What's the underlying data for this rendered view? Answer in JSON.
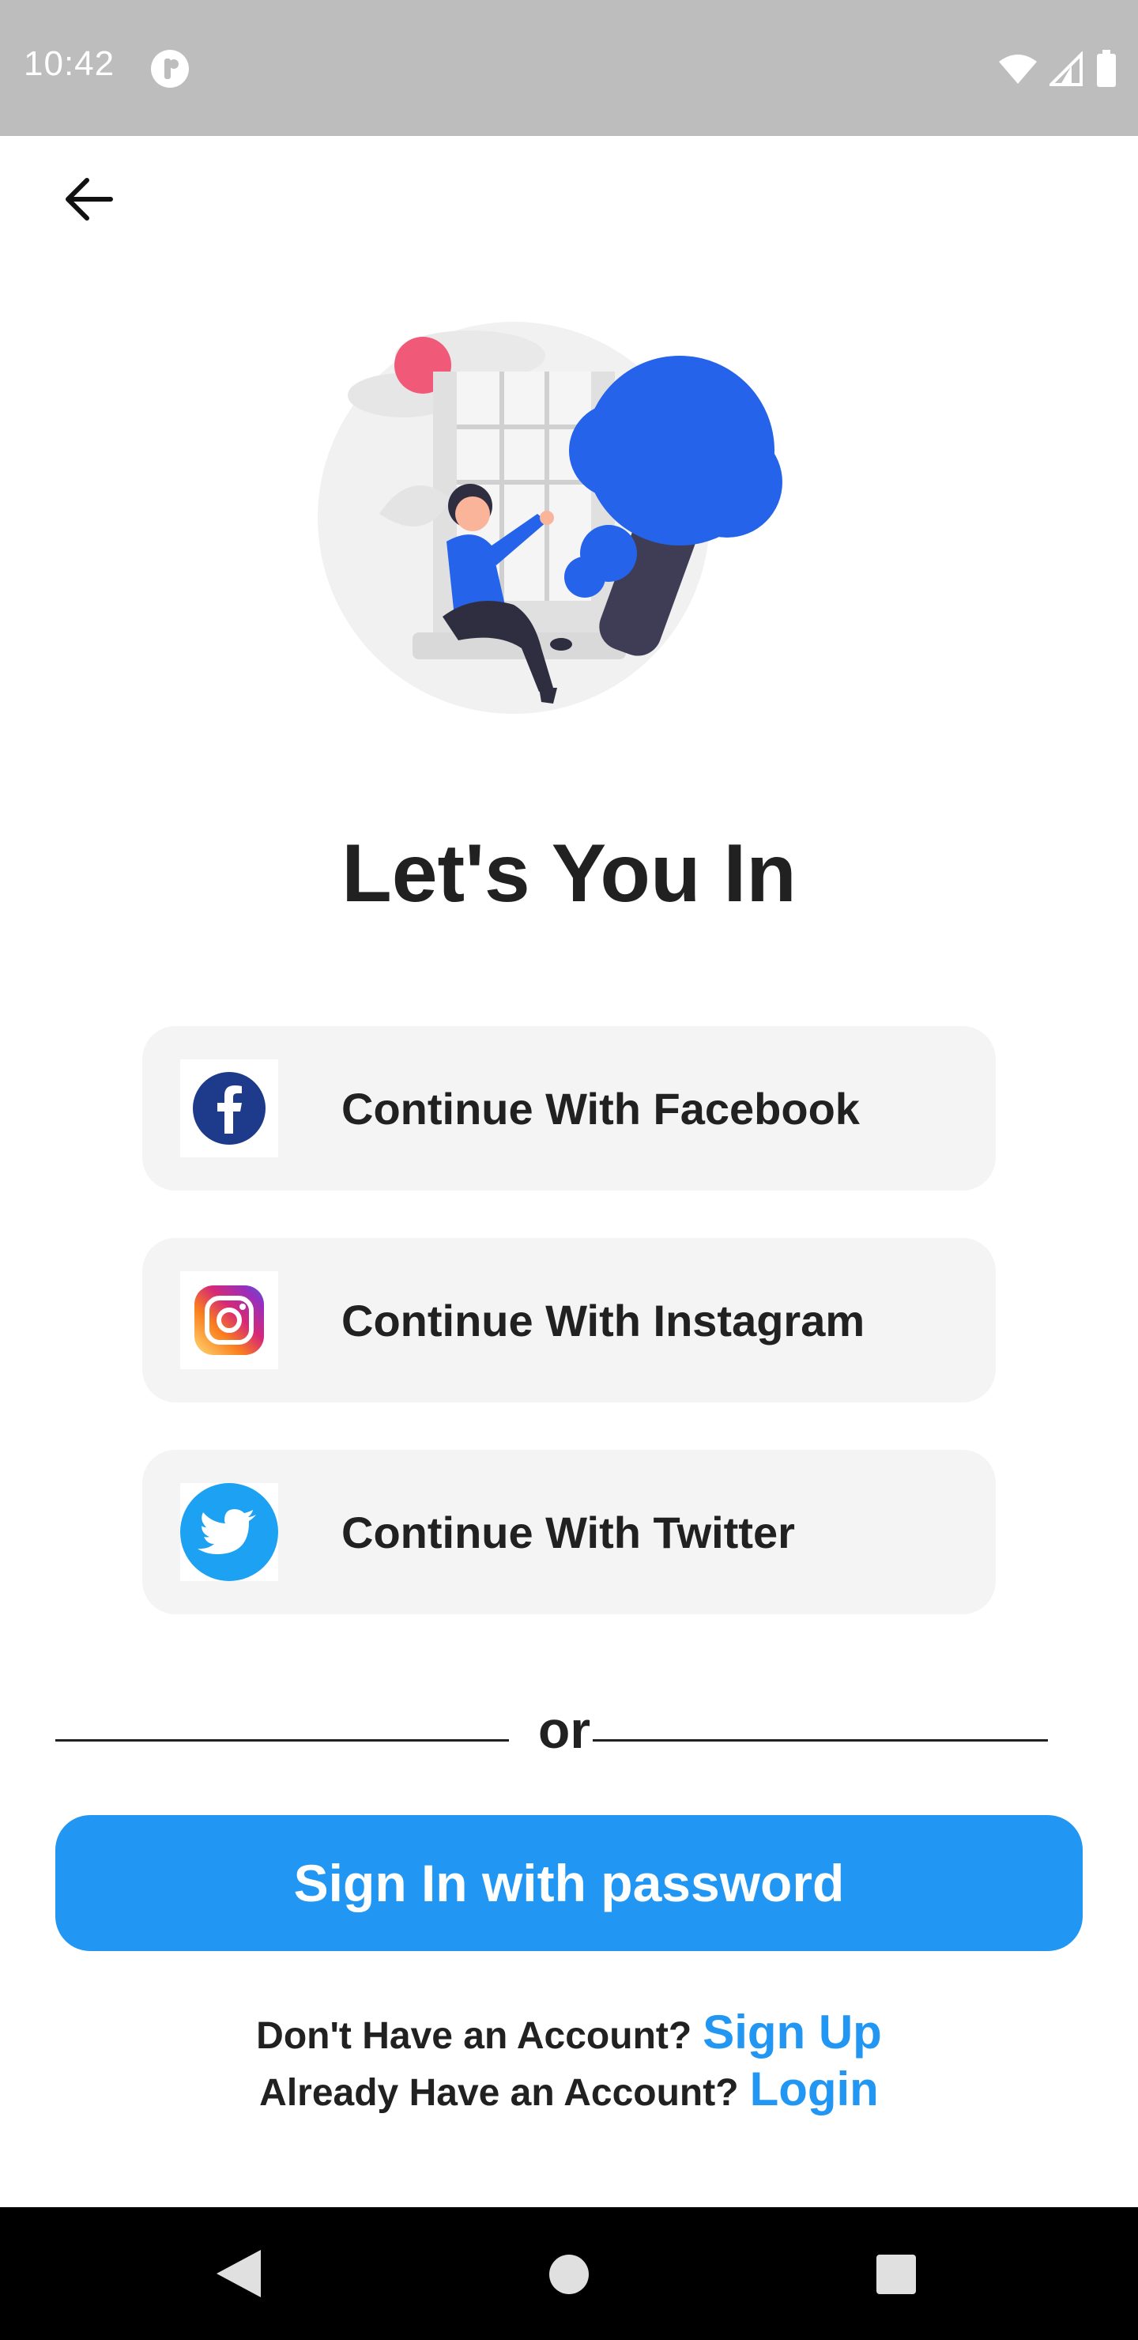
{
  "status_bar": {
    "time": "10:42"
  },
  "header": {
    "back_icon": "arrow-left-icon"
  },
  "page": {
    "title": "Let's You In"
  },
  "social_buttons": [
    {
      "label": "Continue With Facebook",
      "icon": "facebook-icon",
      "color": "#1e3a8a"
    },
    {
      "label": "Continue With Instagram",
      "icon": "instagram-icon",
      "color": "#c13584"
    },
    {
      "label": "Continue With Twitter",
      "icon": "twitter-icon",
      "color": "#1da1f2"
    }
  ],
  "divider": {
    "text": "or"
  },
  "primary_button": {
    "label": "Sign In with password",
    "color": "#2196f3"
  },
  "prompts": {
    "signup_text": "Don't Have an Account?",
    "signup_link": "Sign Up",
    "login_text": "Already Have an Account?",
    "login_link": "Login",
    "link_color": "#2196f3"
  },
  "colors": {
    "accent": "#2196f3",
    "illustration_blue": "#2563eb",
    "text": "#212121",
    "button_bg": "#f4f4f4"
  }
}
